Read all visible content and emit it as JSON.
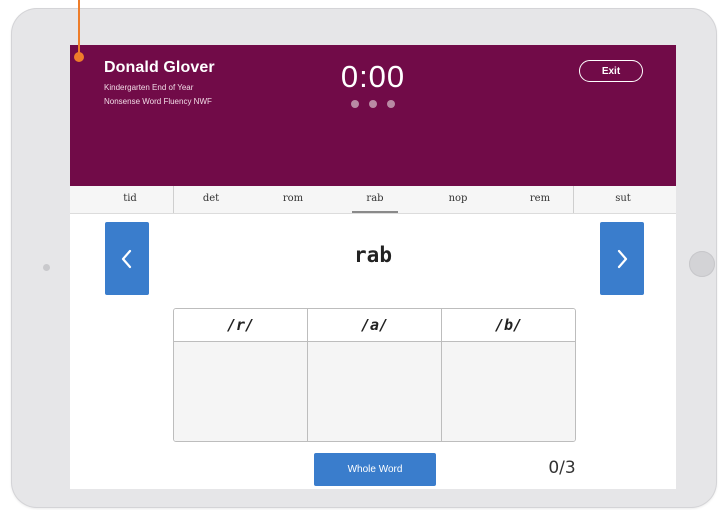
{
  "student": {
    "name": "Donald Glover",
    "grade_line": "Kindergarten  End of Year",
    "test_line": "Nonsense Word Fluency  NWF"
  },
  "timer": {
    "display": "0:00",
    "dots_count": 3
  },
  "exit_label": "Exit",
  "words": [
    "tid",
    "det",
    "rom",
    "rab",
    "nop",
    "rem",
    "sut"
  ],
  "active_word_index": 3,
  "current_word": "rab",
  "sounds": [
    "/r/",
    "/a/",
    "/b/"
  ],
  "whole_word_label": "Whole Word",
  "score": "0/3",
  "icons": {
    "prev": "chevron-left-icon",
    "next": "chevron-right-icon"
  },
  "colors": {
    "header_bg": "#710b48",
    "accent_blue": "#3a7dcc",
    "annotation_orange": "#ee7d2a"
  }
}
